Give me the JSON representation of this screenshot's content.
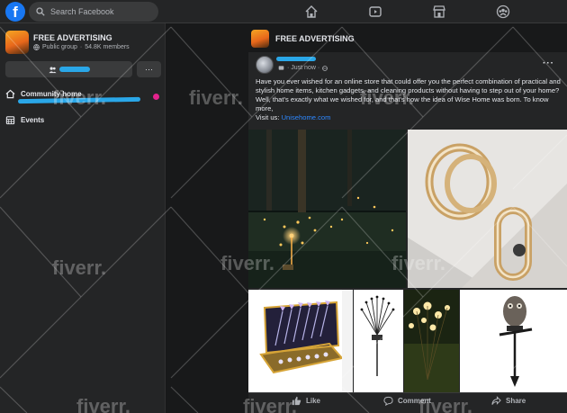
{
  "topbar": {
    "logo": "f",
    "search_placeholder": "Search Facebook",
    "nav_icons": [
      "home-icon",
      "video-icon",
      "marketplace-icon",
      "groups-icon"
    ]
  },
  "sidebar": {
    "group_name": "FREE ADVERTISING",
    "group_type": "Public group",
    "group_members": "54.8K members",
    "more_label": "···",
    "items": [
      {
        "label": "Community home",
        "icon": "home-icon"
      },
      {
        "label": "Events",
        "icon": "calendar-icon"
      }
    ]
  },
  "main": {
    "group_name": "FREE ADVERTISING"
  },
  "post": {
    "time": "· Just now ·",
    "more": "···",
    "text": "Have you ever wished for an online store that could offer you the perfect combination of practical and stylish home items, kitchen gadgets, and cleaning products without having to step out of your home? Well, that's exactly what we wished for, and that's how the idea of Wise Home was born. To know more,",
    "visit_label": "Visit us:",
    "link_text": "Unisehome.com",
    "actions": {
      "like": "Like",
      "comment": "Comment",
      "share": "Share"
    }
  },
  "watermark_text": "fiverr.",
  "colors": {
    "accent": "#1877f2",
    "link": "#2d88ff",
    "notify": "#e4228c",
    "redaction": "#2aa7e8"
  }
}
